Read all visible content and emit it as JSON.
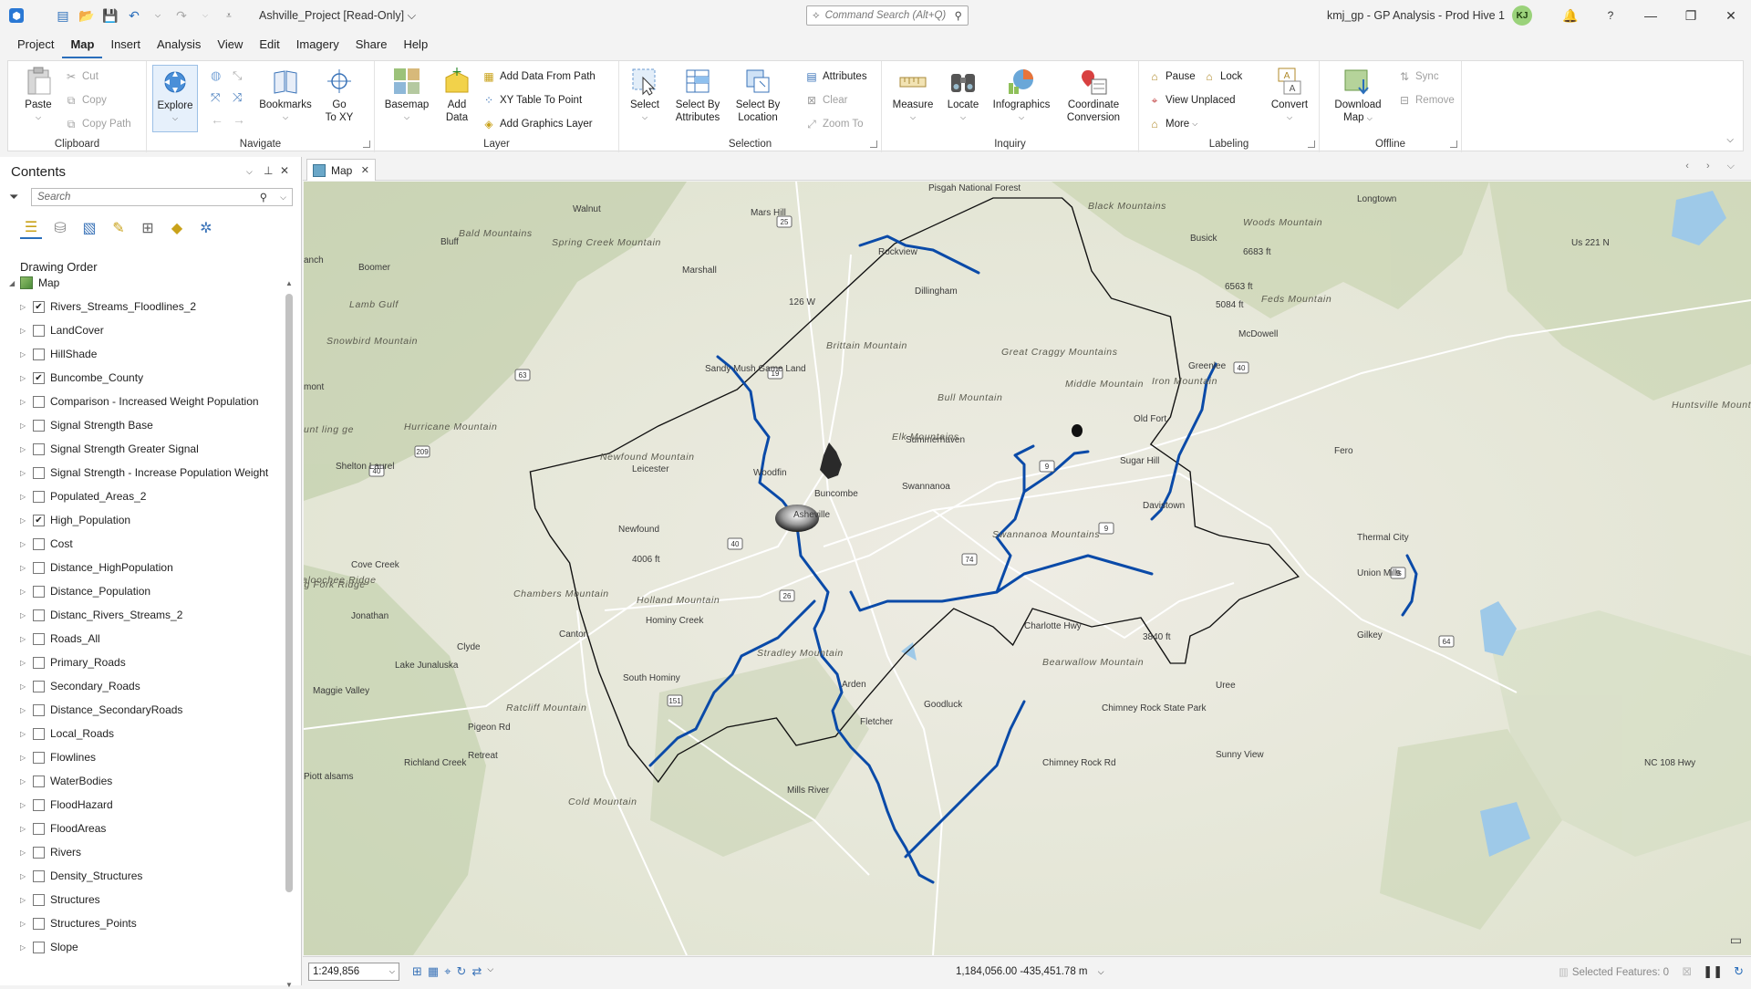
{
  "titlebar": {
    "project_title": "Ashville_Project [Read-Only] ⌵",
    "command_search_placeholder": "Command Search (Alt+Q)",
    "portal_text": "kmj_gp - GP Analysis - Prod Hive 1",
    "user_initials": "KJ"
  },
  "menu_tabs": [
    "Project",
    "Map",
    "Insert",
    "Analysis",
    "View",
    "Edit",
    "Imagery",
    "Share",
    "Help"
  ],
  "active_tab": "Map",
  "ribbon": {
    "clipboard": {
      "label": "Clipboard",
      "paste": "Paste",
      "cut": "Cut",
      "copy": "Copy",
      "copy_path": "Copy Path"
    },
    "navigate": {
      "label": "Navigate",
      "explore": "Explore",
      "bookmarks": "Bookmarks",
      "go_to_xy_1": "Go",
      "go_to_xy_2": "To XY"
    },
    "layer": {
      "label": "Layer",
      "basemap": "Basemap",
      "add_data_1": "Add",
      "add_data_2": "Data",
      "add_data_from_path": "Add Data From Path",
      "xy_table_to_point": "XY Table To Point",
      "add_graphics_layer": "Add Graphics Layer"
    },
    "selection": {
      "label": "Selection",
      "select": "Select",
      "select_by_attr_1": "Select By",
      "select_by_attr_2": "Attributes",
      "select_by_loc_1": "Select By",
      "select_by_loc_2": "Location",
      "attributes": "Attributes",
      "clear": "Clear",
      "zoom_to": "Zoom To"
    },
    "inquiry": {
      "label": "Inquiry",
      "measure": "Measure",
      "locate": "Locate",
      "infographics": "Infographics",
      "coord_conv_1": "Coordinate",
      "coord_conv_2": "Conversion"
    },
    "labeling": {
      "label": "Labeling",
      "pause": "Pause",
      "lock": "Lock",
      "view_unplaced": "View Unplaced",
      "more": "More",
      "convert": "Convert"
    },
    "offline": {
      "label": "Offline",
      "download_map_1": "Download",
      "download_map_2": "Map",
      "sync": "Sync",
      "remove": "Remove"
    }
  },
  "contents": {
    "title": "Contents",
    "search_placeholder": "Search",
    "drawing_order": "Drawing Order",
    "map_label": "Map",
    "layers": [
      {
        "name": "Rivers_Streams_Floodlines_2",
        "checked": true
      },
      {
        "name": "LandCover",
        "checked": false
      },
      {
        "name": "HillShade",
        "checked": false
      },
      {
        "name": "Buncombe_County",
        "checked": true
      },
      {
        "name": "Comparison - Increased Weight Population",
        "checked": false
      },
      {
        "name": "Signal Strength Base",
        "checked": false
      },
      {
        "name": "Signal Strength Greater Signal",
        "checked": false
      },
      {
        "name": "Signal Strength - Increase Population Weight",
        "checked": false
      },
      {
        "name": "Populated_Areas_2",
        "checked": false
      },
      {
        "name": "High_Population",
        "checked": true
      },
      {
        "name": "Cost",
        "checked": false
      },
      {
        "name": "Distance_HighPopulation",
        "checked": false
      },
      {
        "name": "Distance_Population",
        "checked": false
      },
      {
        "name": "Distanc_Rivers_Streams_2",
        "checked": false
      },
      {
        "name": "Roads_All",
        "checked": false
      },
      {
        "name": "Primary_Roads",
        "checked": false
      },
      {
        "name": "Secondary_Roads",
        "checked": false
      },
      {
        "name": "Distance_SecondaryRoads",
        "checked": false
      },
      {
        "name": "Local_Roads",
        "checked": false
      },
      {
        "name": "Flowlines",
        "checked": false
      },
      {
        "name": "WaterBodies",
        "checked": false
      },
      {
        "name": "FloodHazard",
        "checked": false
      },
      {
        "name": "FloodAreas",
        "checked": false
      },
      {
        "name": "Rivers",
        "checked": false
      },
      {
        "name": "Density_Structures",
        "checked": false
      },
      {
        "name": "Structures",
        "checked": false
      },
      {
        "name": "Structures_Points",
        "checked": false
      },
      {
        "name": "Slope",
        "checked": false
      }
    ]
  },
  "map_view": {
    "tab_label": "Map",
    "places": [
      "Walnut",
      "Mars Hill",
      "Rockview",
      "Marshall",
      "Dillingham",
      "Boomer",
      "Bluff",
      "Sandy Mush Game Land",
      "Leicester",
      "Woodfin",
      "Asheville",
      "Newfound",
      "Shelton Laurel",
      "Cove Creek",
      "Jonathan",
      "Canton",
      "Clyde",
      "Lake Junaluska",
      "Maggie Valley",
      "South Hominy",
      "Pigeon Rd",
      "Retreat",
      "Arden",
      "Fletcher",
      "Goodluck",
      "Mills River",
      "Summerhaven",
      "Swannanoa",
      "Busick",
      "Greenlee",
      "Old Fort",
      "Sugar Hill",
      "Davistown",
      "Fero",
      "Thermal City",
      "Union Mills",
      "Gilkey",
      "Uree",
      "Sunny View",
      "Longtown",
      "Pisgah National Forest",
      "McDowell",
      "Chimney Rock State Park",
      "Charlotte Hwy",
      "Buncombe",
      "Hominy Creek",
      "Richland Creek",
      "Chimney Rock Rd",
      "NC 108 Hwy",
      "Us 221 N",
      "126 W",
      "6683 ft",
      "6563 ft",
      "5084 ft",
      "4006 ft",
      "3840 ft",
      "mont",
      "anch",
      "Piott alsams"
    ],
    "ranges": [
      "Bald Mountains",
      "Spring Creek Mountain",
      "Lamb Gulf",
      "Snowbird Mountain",
      "Hurricane Mountain",
      "Newfound Mountain",
      "Brittain Mountain",
      "Bull Mountain",
      "Great Craggy Mountains",
      "Elk Mountains",
      "Middle Mountain",
      "Black Mountains",
      "Woods Mountain",
      "Feds Mountain",
      "Iron Mountain",
      "Huntsville Mountains",
      "Swannanoa Mountains",
      "Chambers Mountain",
      "Holland Mountain",
      "Stradley Mountain",
      "Ratcliff Mountain",
      "Bearwallow Mountain",
      "Cold Mountain",
      "Cataloochee Ridge",
      "Big Fork Ridge",
      "unt ling ge"
    ],
    "shields": [
      "25",
      "19",
      "63",
      "209",
      "40",
      "40",
      "9",
      "9",
      "74",
      "26",
      "151",
      "40",
      "64",
      "9"
    ]
  },
  "statusbar": {
    "scale": "1:249,856",
    "coordinates": "1,184,056.00 -435,451.78 m",
    "selected_features": "Selected Features: 0"
  },
  "colors": {
    "river": "#0a4aa8",
    "county_boundary": "#111111",
    "accent": "#2a6ebb"
  }
}
